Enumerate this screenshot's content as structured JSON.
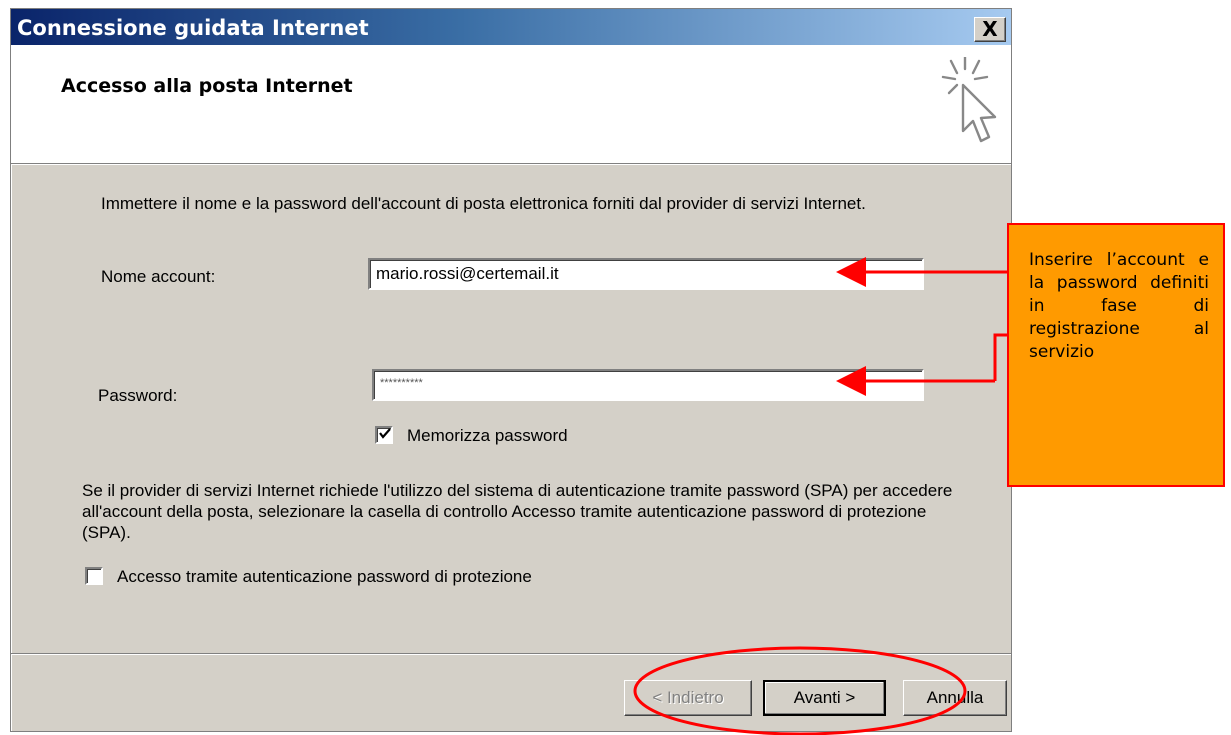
{
  "window": {
    "title": "Connessione guidata Internet",
    "close_label": "X"
  },
  "header": {
    "title": "Accesso alla posta Internet",
    "icon": "wizard-cursor-icon"
  },
  "body": {
    "intro_text": "Immettere il nome e la password dell'account di posta elettronica forniti dal provider di servizi Internet.",
    "account_label": "Nome account:",
    "account_value": "mario.rossi@certemail.it",
    "password_label": "Password:",
    "password_value": "**********",
    "remember_label": "Memorizza password",
    "remember_checked": true,
    "spa_text": "Se il provider di servizi Internet richiede l'utilizzo del sistema di autenticazione tramite password (SPA) per accedere all'account della posta, selezionare la casella di controllo Accesso tramite autenticazione password di protezione (SPA).",
    "spa_label": "Accesso tramite autenticazione password di protezione",
    "spa_checked": false
  },
  "buttons": {
    "back": "< Indietro",
    "next": "Avanti >",
    "cancel": "Annulla"
  },
  "annotation": {
    "text": "Inserire l’account e la password definiti in fase di registrazione al servizio",
    "colors": {
      "fill": "#ff9a00",
      "border": "#ff0000",
      "arrow": "#ff0000"
    }
  }
}
